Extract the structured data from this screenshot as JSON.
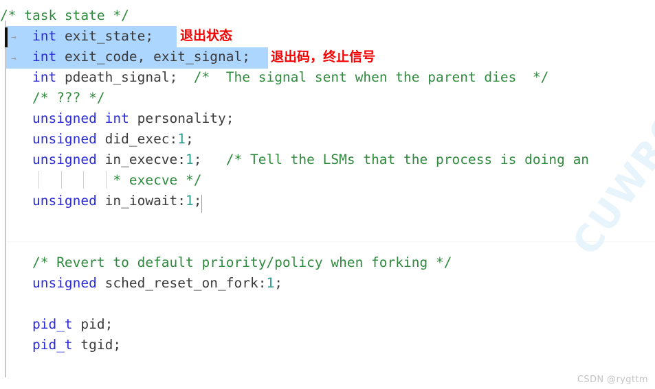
{
  "editor": {
    "language": "c",
    "colors": {
      "background": "#ffffff",
      "keyword": "#2b2bd8",
      "comment": "#2f8a3e",
      "identifier": "#3a3a3a",
      "number": "#2a9d8f",
      "selection": "#add6ff",
      "annotation": "#f40000",
      "gutter_rule": "#c9c9c9",
      "caret": "#111111"
    },
    "code_lines": [
      {
        "segments": [
          {
            "t": "/* task state */",
            "c": "cmt"
          }
        ]
      },
      {
        "segments": [
          {
            "t": "    ",
            "c": "punc"
          },
          {
            "t": "int",
            "c": "kw"
          },
          {
            "t": " exit_state;",
            "c": "id"
          }
        ]
      },
      {
        "segments": [
          {
            "t": "    ",
            "c": "punc"
          },
          {
            "t": "int",
            "c": "kw"
          },
          {
            "t": " exit_code, exit_signal;",
            "c": "id"
          }
        ]
      },
      {
        "segments": [
          {
            "t": "    ",
            "c": "punc"
          },
          {
            "t": "int",
            "c": "kw"
          },
          {
            "t": " pdeath_signal;  ",
            "c": "id"
          },
          {
            "t": "/*  The signal sent when the parent dies  */",
            "c": "cmt"
          }
        ]
      },
      {
        "segments": [
          {
            "t": "    ",
            "c": "punc"
          },
          {
            "t": "/* ??? */",
            "c": "cmt"
          }
        ]
      },
      {
        "segments": [
          {
            "t": "    ",
            "c": "punc"
          },
          {
            "t": "unsigned int",
            "c": "kw"
          },
          {
            "t": " personality;",
            "c": "id"
          }
        ]
      },
      {
        "segments": [
          {
            "t": "    ",
            "c": "punc"
          },
          {
            "t": "unsigned",
            "c": "kw"
          },
          {
            "t": " did_exec:",
            "c": "id"
          },
          {
            "t": "1",
            "c": "num"
          },
          {
            "t": ";",
            "c": "id"
          }
        ]
      },
      {
        "segments": [
          {
            "t": "    ",
            "c": "punc"
          },
          {
            "t": "unsigned",
            "c": "kw"
          },
          {
            "t": " in_execve:",
            "c": "id"
          },
          {
            "t": "1",
            "c": "num"
          },
          {
            "t": ";   ",
            "c": "id"
          },
          {
            "t": "/* Tell the LSMs that the process is doing an",
            "c": "cmt"
          }
        ]
      },
      {
        "segments": [
          {
            "t": "              ",
            "c": "punc"
          },
          {
            "t": "* execve */",
            "c": "cmt"
          }
        ]
      },
      {
        "segments": [
          {
            "t": "    ",
            "c": "punc"
          },
          {
            "t": "unsigned",
            "c": "kw"
          },
          {
            "t": " in_iowait:",
            "c": "id"
          },
          {
            "t": "1",
            "c": "num"
          },
          {
            "t": ";",
            "c": "id"
          }
        ]
      },
      {
        "segments": []
      },
      {
        "segments": []
      },
      {
        "segments": [
          {
            "t": "    ",
            "c": "punc"
          },
          {
            "t": "/* Revert to default priority/policy when forking */",
            "c": "cmt"
          }
        ]
      },
      {
        "segments": [
          {
            "t": "    ",
            "c": "punc"
          },
          {
            "t": "unsigned",
            "c": "kw"
          },
          {
            "t": " sched_reset_on_fork:",
            "c": "id"
          },
          {
            "t": "1",
            "c": "num"
          },
          {
            "t": ";",
            "c": "id"
          }
        ]
      },
      {
        "segments": []
      },
      {
        "segments": [
          {
            "t": "    ",
            "c": "punc"
          },
          {
            "t": "pid_t",
            "c": "kw"
          },
          {
            "t": " pid;",
            "c": "id"
          }
        ]
      },
      {
        "segments": [
          {
            "t": "    ",
            "c": "punc"
          },
          {
            "t": "pid_t",
            "c": "kw"
          },
          {
            "t": " tgid;",
            "c": "id"
          }
        ]
      }
    ],
    "line_plain_text": [
      "/* task state */",
      "    int exit_state;",
      "    int exit_code, exit_signal;",
      "    int pdeath_signal;  /*  The signal sent when the parent dies  */",
      "    /* ??? */",
      "    unsigned int personality;",
      "    unsigned did_exec:1;",
      "    unsigned in_execve:1;   /* Tell the LSMs that the process is doing an",
      "              * execve */",
      "    unsigned in_iowait:1;",
      "",
      "",
      "    /* Revert to default priority/policy when forking */",
      "    unsigned sched_reset_on_fork:1;",
      "",
      "    pid_t pid;",
      "    pid_t tgid;"
    ],
    "selected_lines": [
      "    int exit_state;",
      "    int exit_code, exit_signal;"
    ],
    "tab_markers": [
      "→",
      "→"
    ]
  },
  "annotations": [
    {
      "text": "退出状态",
      "for_line": "    int exit_state;"
    },
    {
      "text": "退出码，终止信号",
      "for_line": "    int exit_code, exit_signal;"
    }
  ],
  "watermarks": {
    "diagonal": "CUWRO",
    "corner": "CSDN @rygttm"
  }
}
